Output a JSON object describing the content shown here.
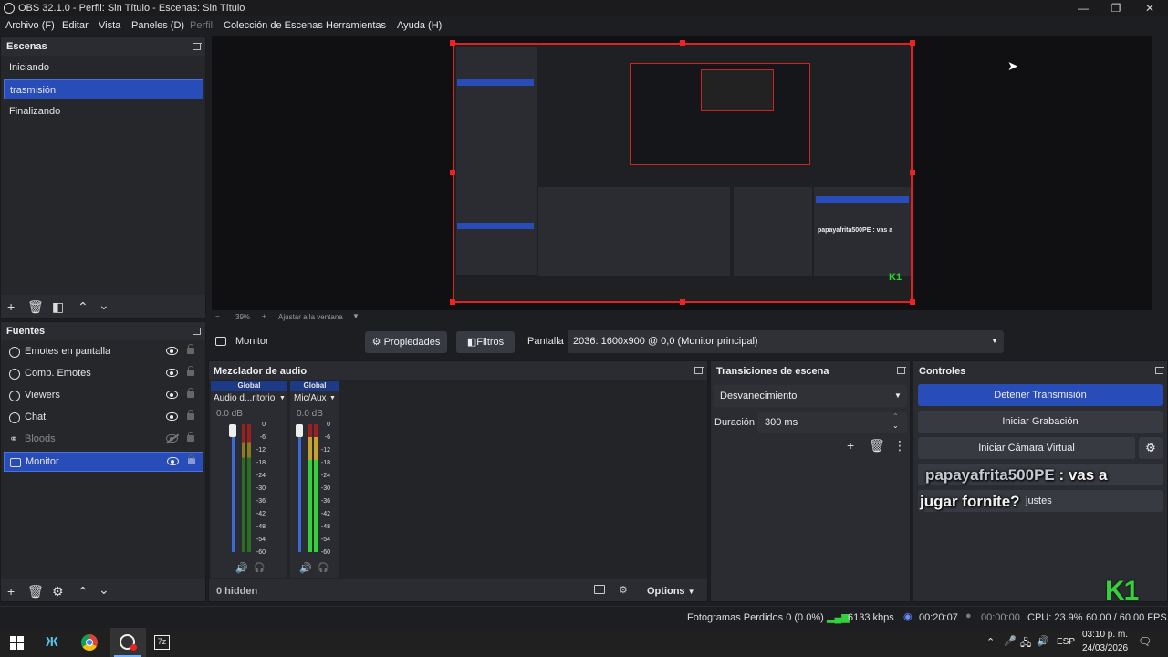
{
  "window": {
    "title": "OBS 32.1.0 - Perfil: Sin Título - Escenas: Sin Título",
    "minimize": "—",
    "maximize": "❐",
    "close": "✕"
  },
  "menu": {
    "items": [
      "Archivo (F)",
      "Editar",
      "Vista",
      "Paneles (D)",
      "Perfil",
      "Colección de Escenas",
      "Herramientas",
      "Ayuda (H)"
    ],
    "disabled_index": 4
  },
  "scenes": {
    "title": "Escenas",
    "items": [
      "Iniciando",
      "trasmisión",
      "Finalizando"
    ],
    "selected": "trasmisión"
  },
  "sources": {
    "title": "Fuentes",
    "items": [
      {
        "label": "Emotes en pantalla",
        "visible": true,
        "icon": "browser-icon"
      },
      {
        "label": "Comb. Emotes",
        "visible": true,
        "icon": "browser-icon"
      },
      {
        "label": "Viewers",
        "visible": true,
        "icon": "browser-icon"
      },
      {
        "label": "Chat",
        "visible": true,
        "icon": "browser-icon"
      },
      {
        "label": "Bloods",
        "visible": false,
        "icon": "link-icon"
      },
      {
        "label": "Monitor",
        "visible": true,
        "icon": "monitor-icon"
      }
    ],
    "selected": "Monitor"
  },
  "preview": {
    "zoom": "39%",
    "fit_label": "Ajustar a la ventana",
    "minus": "−",
    "plus": "+"
  },
  "source_toolbar": {
    "source_name": "Monitor",
    "properties_label": "Propiedades",
    "filters_label": "Filtros",
    "display_label": "Pantalla",
    "display_value": "2036: 1600x900 @ 0,0 (Monitor principal)"
  },
  "mixer": {
    "title": "Mezclador de audio",
    "channels": [
      {
        "tag": "Global",
        "name": "Audio d...ritorio",
        "db": "0.0 dB"
      },
      {
        "tag": "Global",
        "name": "Mic/Aux",
        "db": "0.0 dB"
      }
    ],
    "ticks": [
      "0",
      "-6",
      "-12",
      "-18",
      "-24",
      "-30",
      "-36",
      "-42",
      "-48",
      "-54",
      "-60"
    ],
    "hidden_label": "0 hidden",
    "options_label": "Options"
  },
  "transitions": {
    "title": "Transiciones de escena",
    "type": "Desvanecimiento",
    "duration_label": "Duración",
    "duration_value": "300 ms"
  },
  "controls": {
    "title": "Controles",
    "stop_stream": "Detener Transmisión",
    "start_recording": "Iniciar Grabación",
    "start_virtual_cam": "Iniciar Cámara Virtual",
    "settings_partial": "justes"
  },
  "chat_overlay": {
    "user": "papayafrita500PE",
    "message_part1": " : vas a",
    "message_part2": "jugar fornite?"
  },
  "logo_text": "K1",
  "status": {
    "dropped_frames": "Fotogramas Perdidos 0 (0.0%)",
    "bitrate": "6133 kbps",
    "stream_time": "00:20:07",
    "record_time": "00:00:00",
    "cpu": "CPU: 23.9%",
    "fps": "60.00 / 60.00 FPS"
  },
  "taskbar": {
    "language": "ESP",
    "time": "03:10 p. m.",
    "date": "24/03/2026"
  },
  "colors": {
    "accent": "#284cb8",
    "preview_border": "#dd2222",
    "background": "#1d1e22",
    "dock": "#2a2c31"
  }
}
